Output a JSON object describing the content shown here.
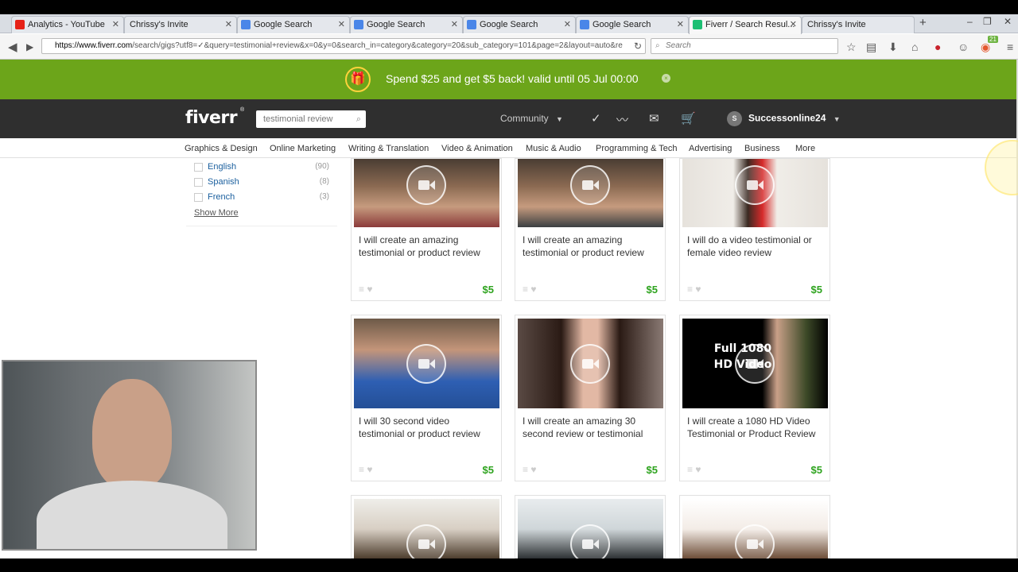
{
  "browser": {
    "tabs": [
      {
        "label": "Analytics - YouTube",
        "icon": "youtube-icon",
        "color": "#e62117"
      },
      {
        "label": "Chrissy's Invite",
        "icon": "page-icon",
        "color": "#ffffff"
      },
      {
        "label": "Google Search",
        "icon": "google-icon",
        "color": "#4a86e8"
      },
      {
        "label": "Google Search",
        "icon": "google-icon",
        "color": "#4a86e8"
      },
      {
        "label": "Google Search",
        "icon": "google-icon",
        "color": "#4a86e8"
      },
      {
        "label": "Google Search",
        "icon": "google-icon",
        "color": "#4a86e8"
      },
      {
        "label": "Fiverr / Search Resul...",
        "icon": "fiverr-icon",
        "color": "#1dbf73",
        "active": true
      },
      {
        "label": "Chrissy's Invite",
        "icon": "page-icon",
        "color": "#ffffff"
      }
    ],
    "new_tab": "+",
    "url_host": "https://www.fiverr.com",
    "url_rest": "/search/gigs?utf8=✓&query=testimonial+review&x=0&y=0&search_in=category&category=20&sub_category=101&page=2&layout=auto&re",
    "search_placeholder": "Search",
    "badge_count": "21"
  },
  "promo": {
    "text": "Spend $25 and get $5 back! valid until 05 Jul 00:00",
    "close": "×",
    "accent": "#6ca51a"
  },
  "header": {
    "logo": "fiverr",
    "search_value": "testimonial review",
    "community": "Community",
    "username": "Successonline24",
    "avatar_letter": "S"
  },
  "categories": [
    "Graphics & Design",
    "Online Marketing",
    "Writing & Translation",
    "Video & Animation",
    "Music & Audio",
    "Programming & Tech",
    "Advertising",
    "Business",
    "More"
  ],
  "filters": {
    "items": [
      {
        "label": "English",
        "count": "(90)"
      },
      {
        "label": "Spanish",
        "count": "(8)"
      },
      {
        "label": "French",
        "count": "(3)"
      }
    ],
    "show_more": "Show More"
  },
  "gigs": [
    {
      "title": "I will create an amazing testimonial or product review",
      "price": "$5"
    },
    {
      "title": "I will create an amazing testimonial or product review",
      "price": "$5"
    },
    {
      "title": "I will do a video testimonial or female video review",
      "price": "$5"
    },
    {
      "title": "I will 30 second video testimonial or product review",
      "price": "$5"
    },
    {
      "title": "I will create an amazing 30 second review or testimonial",
      "price": "$5"
    },
    {
      "title": "I will create a 1080 HD Video Testimonial or Product Review",
      "price": "$5"
    }
  ],
  "thumb_overlay_text": "Full 1080 HD Video",
  "price_color": "#2ea31e"
}
